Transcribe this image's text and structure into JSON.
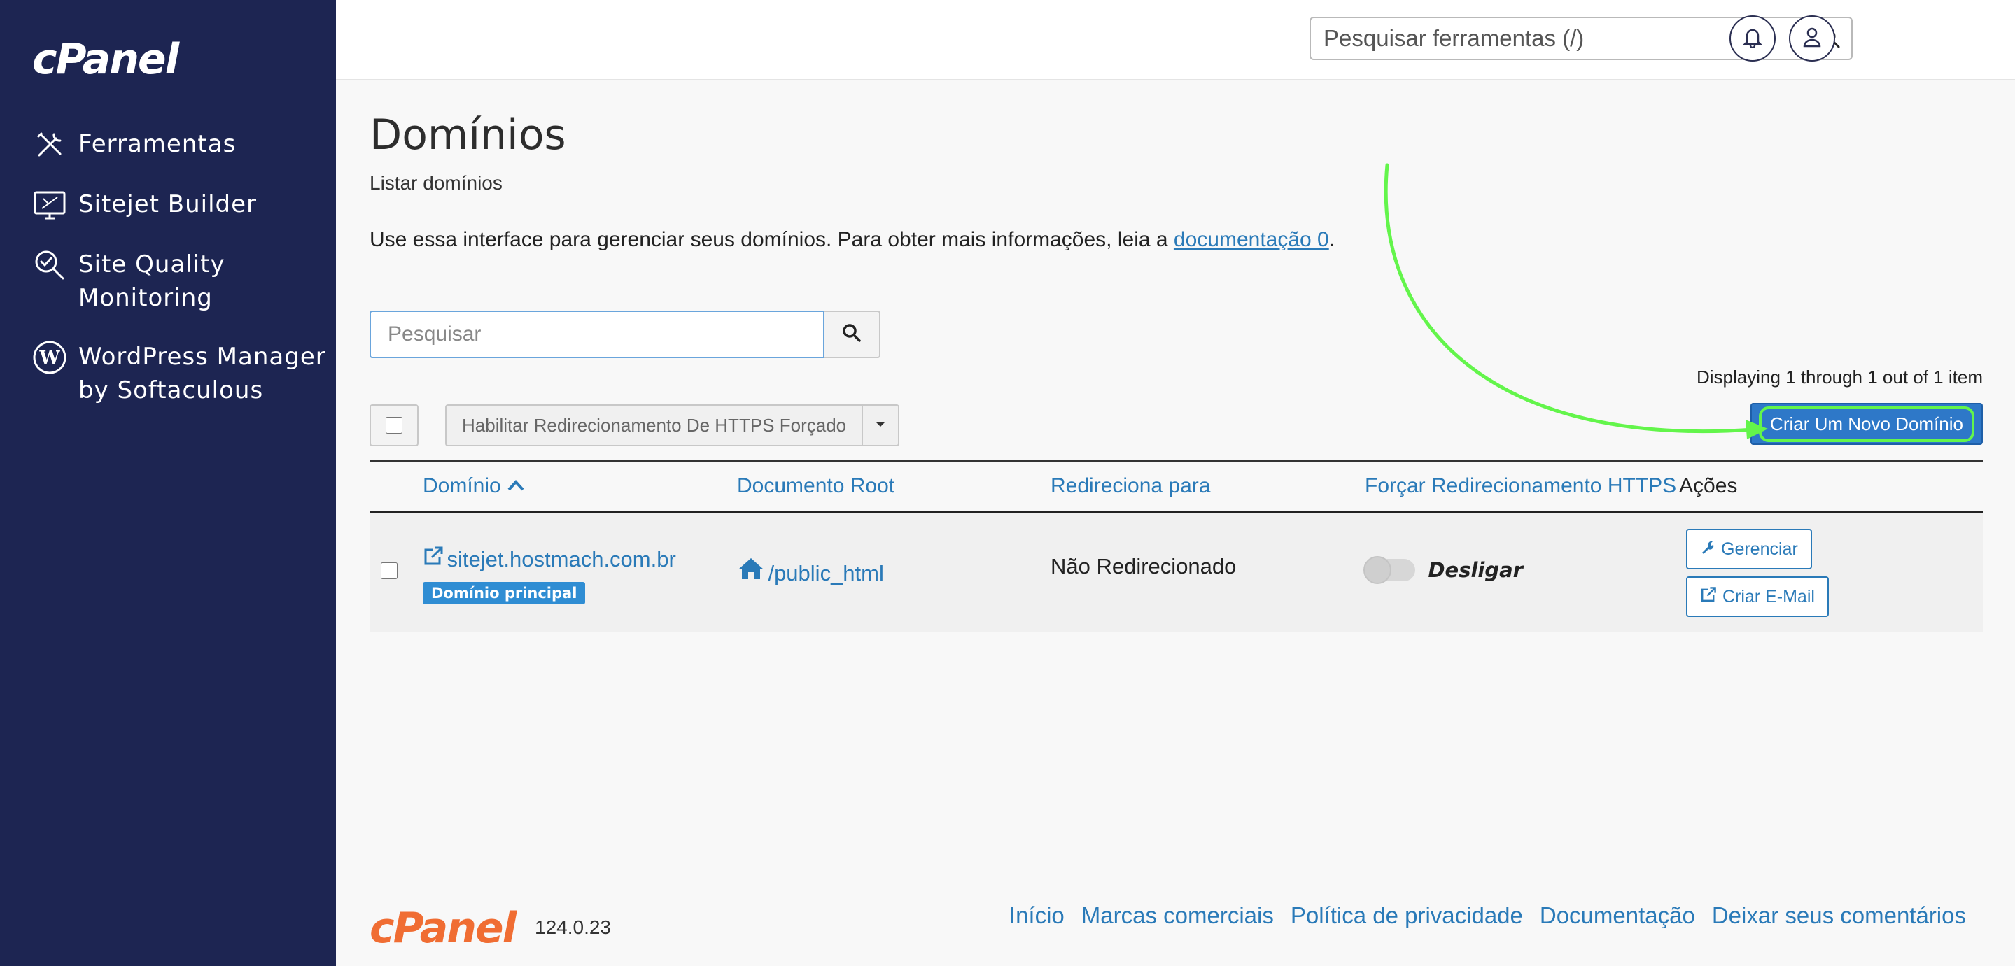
{
  "brand": {
    "logo_text": "cPanel",
    "version": "124.0.23"
  },
  "sidebar": {
    "items": [
      {
        "label": "Ferramentas",
        "icon": "tools-icon"
      },
      {
        "label": "Sitejet Builder",
        "icon": "sitejet-icon"
      },
      {
        "label": "Site Quality Monitoring",
        "icon": "site-quality-icon"
      },
      {
        "label": "WordPress Manager by Softaculous",
        "icon": "wordpress-icon"
      }
    ]
  },
  "header": {
    "search_placeholder": "Pesquisar ferramentas (/)"
  },
  "page": {
    "title": "Domínios",
    "subtitle": "Listar domínios",
    "intro_text": "Use essa interface para gerenciar seus domínios. Para obter mais informações, leia a ",
    "intro_link": "documentação 0",
    "intro_end": "."
  },
  "toolbar": {
    "search_placeholder": "Pesquisar",
    "displaying": "Displaying 1 through 1 out of 1 item",
    "bulk_action": "Habilitar Redirecionamento De HTTPS Forçado",
    "create_button": "Criar Um Novo Domínio"
  },
  "table": {
    "columns": [
      "Domínio",
      "Documento Root",
      "Redireciona para",
      "Forçar Redirecionamento HTTPS",
      "Ações"
    ],
    "rows": [
      {
        "domain": "sitejet.hostmach.com.br",
        "badge": "Domínio principal",
        "doc_root": "/public_html",
        "redirect": "Não Redirecionado",
        "https_toggle": "Desligar",
        "actions": [
          "Gerenciar",
          "Criar E-Mail"
        ]
      }
    ]
  },
  "footer": {
    "links": [
      "Início",
      "Marcas comerciais",
      "Política de privacidade",
      "Documentação",
      "Deixar seus comentários"
    ]
  },
  "colors": {
    "sidebar_bg": "#1d2552",
    "link": "#2a7ab8",
    "primary_button": "#2e78c8",
    "annotation": "#63f54b",
    "footer_logo": "#f06d33"
  }
}
